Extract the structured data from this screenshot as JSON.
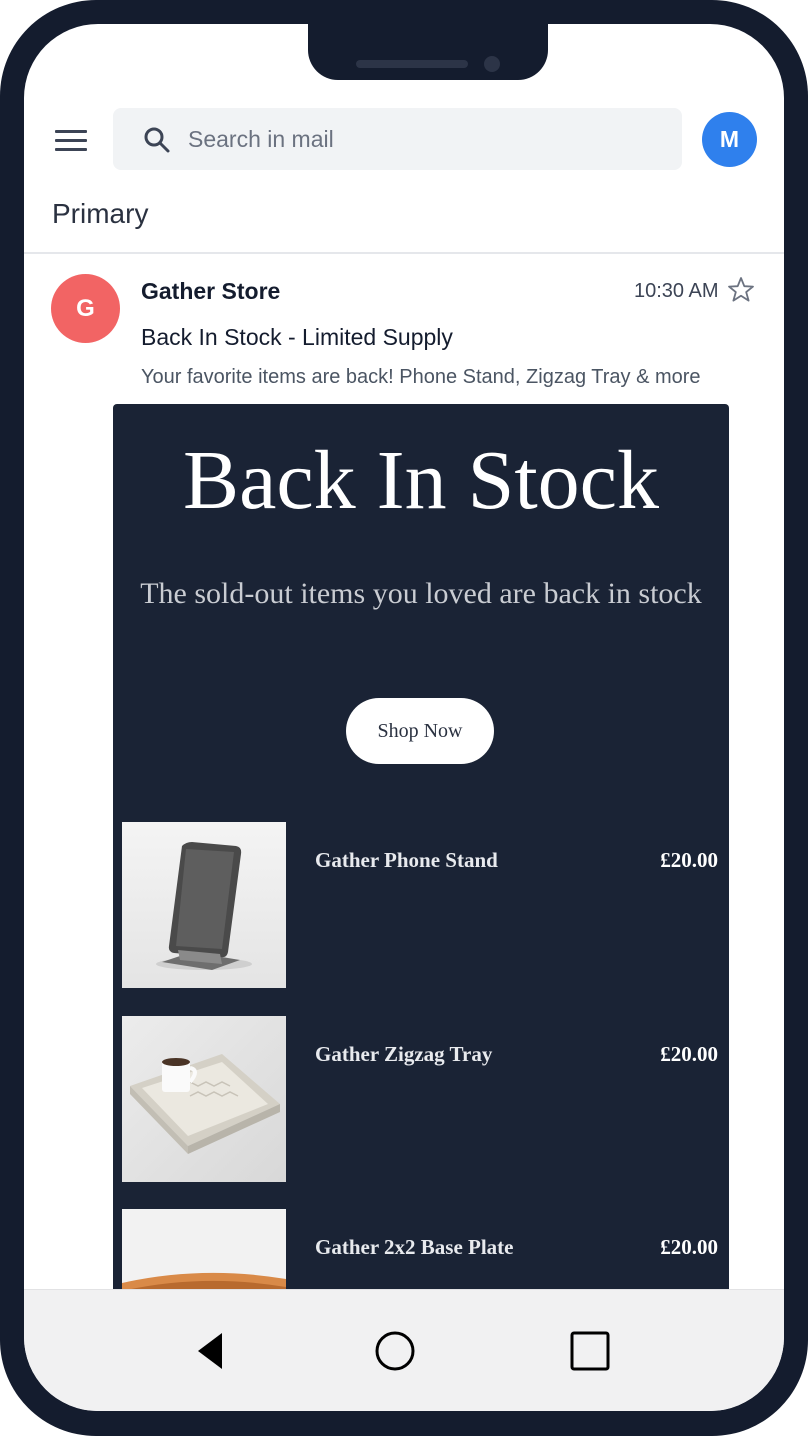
{
  "header": {
    "search_placeholder": "Search in mail",
    "account_initial": "M",
    "account_color": "#2f80ed"
  },
  "mailbox": {
    "section_title": "Primary"
  },
  "email": {
    "sender_initial": "G",
    "sender_avatar_color": "#f26464",
    "sender_name": "Gather Store",
    "time": "10:30 AM",
    "subject": "Back In Stock - Limited Supply",
    "snippet": "Your favorite items are back! Phone Stand, Zigzag Tray & more",
    "starred": false
  },
  "email_body": {
    "background_color": "#1a2335",
    "heading": "Back In Stock",
    "subheading": "The sold-out items you loved are back in stock",
    "cta_label": "Shop Now",
    "products": [
      {
        "name": "Gather Phone Stand",
        "price": "£20.00",
        "image": "phone-stand"
      },
      {
        "name": "Gather Zigzag Tray",
        "price": "£20.00",
        "image": "zigzag-tray"
      },
      {
        "name": "Gather 2x2 Base Plate",
        "price": "£20.00",
        "image": "base-plate"
      }
    ]
  },
  "nav_bar": {
    "icons": [
      "back-icon",
      "home-icon",
      "recents-icon"
    ]
  }
}
